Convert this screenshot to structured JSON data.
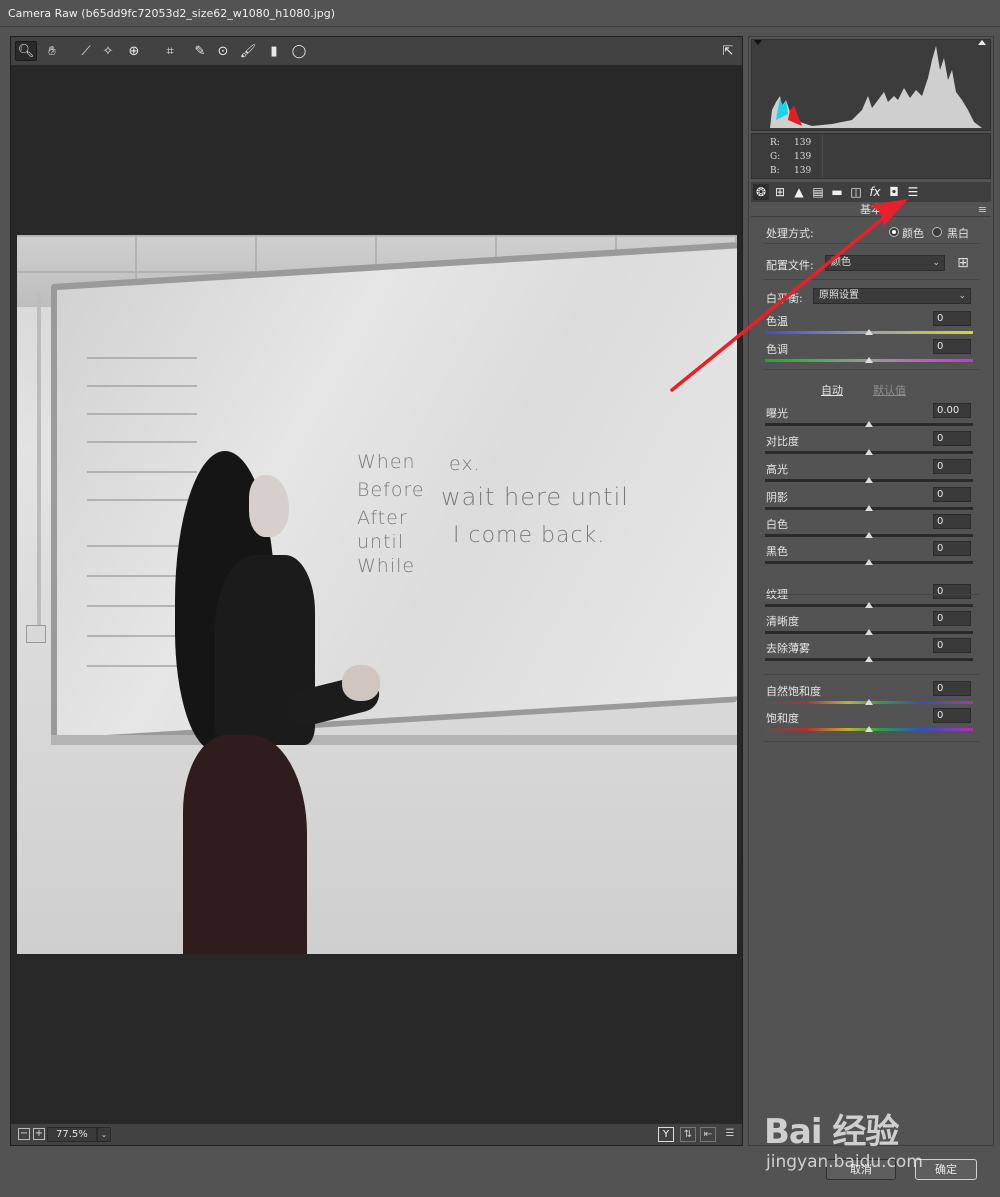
{
  "window": {
    "title": "Camera Raw (b65dd9fc72053d2_size62_w1080_h1080.jpg)"
  },
  "toolbar": {
    "tools": [
      "zoom-tool-icon",
      "hand-tool-icon",
      "white-balance-icon",
      "color-sampler-icon",
      "targeted-adjustment-icon",
      "crop-icon",
      "spot-removal-icon",
      "red-eye-icon",
      "adjustment-brush-icon",
      "graduated-filter-icon",
      "radial-filter-icon"
    ],
    "open_prefs": "preferences-icon"
  },
  "photo": {
    "board_text_left": [
      "When",
      "Before",
      "After",
      "until",
      "While"
    ],
    "board_text_ex": "ex.",
    "board_text_line1": "wait here until",
    "board_text_line2": "I come back."
  },
  "status": {
    "zoom_value": "77.5%",
    "zoom_out": "−",
    "zoom_in": "+",
    "view_mode": "Y"
  },
  "histogram": {
    "r_label": "R:",
    "g_label": "G:",
    "b_label": "B:",
    "r": "139",
    "g": "139",
    "b": "139"
  },
  "panel": {
    "section_title": "基本",
    "treatment_label": "处理方式:",
    "treatment_color": "颜色",
    "treatment_bw": "黑白",
    "profile_label": "配置文件:",
    "profile_value": "颜色",
    "wb_label": "白平衡:",
    "wb_value": "原照设置",
    "auto_link": "自动",
    "default_link": "默认值"
  },
  "sliders": [
    {
      "label": "色温",
      "value": "0",
      "track": "temp"
    },
    {
      "label": "色调",
      "value": "0",
      "track": "tint"
    },
    {
      "label": "曝光",
      "value": "0.00",
      "track": "dark"
    },
    {
      "label": "对比度",
      "value": "0",
      "track": "dark"
    },
    {
      "label": "高光",
      "value": "0",
      "track": "dark"
    },
    {
      "label": "阴影",
      "value": "0",
      "track": "dark"
    },
    {
      "label": "白色",
      "value": "0",
      "track": "dark"
    },
    {
      "label": "黑色",
      "value": "0",
      "track": "dark"
    },
    {
      "label": "纹理",
      "value": "0",
      "track": "dark"
    },
    {
      "label": "清晰度",
      "value": "0",
      "track": "dark"
    },
    {
      "label": "去除薄雾",
      "value": "0",
      "track": "dark"
    },
    {
      "label": "自然饱和度",
      "value": "0",
      "track": "sat"
    },
    {
      "label": "饱和度",
      "value": "0",
      "track": "sat"
    }
  ],
  "buttons": {
    "cancel": "取消",
    "ok": "确定"
  },
  "watermark": {
    "logo": "Bai 经验",
    "url": "jingyan.baidu.com"
  },
  "colors": {
    "annotation_arrow": "#e8202a",
    "background": "#535353",
    "canvas": "#282828"
  }
}
